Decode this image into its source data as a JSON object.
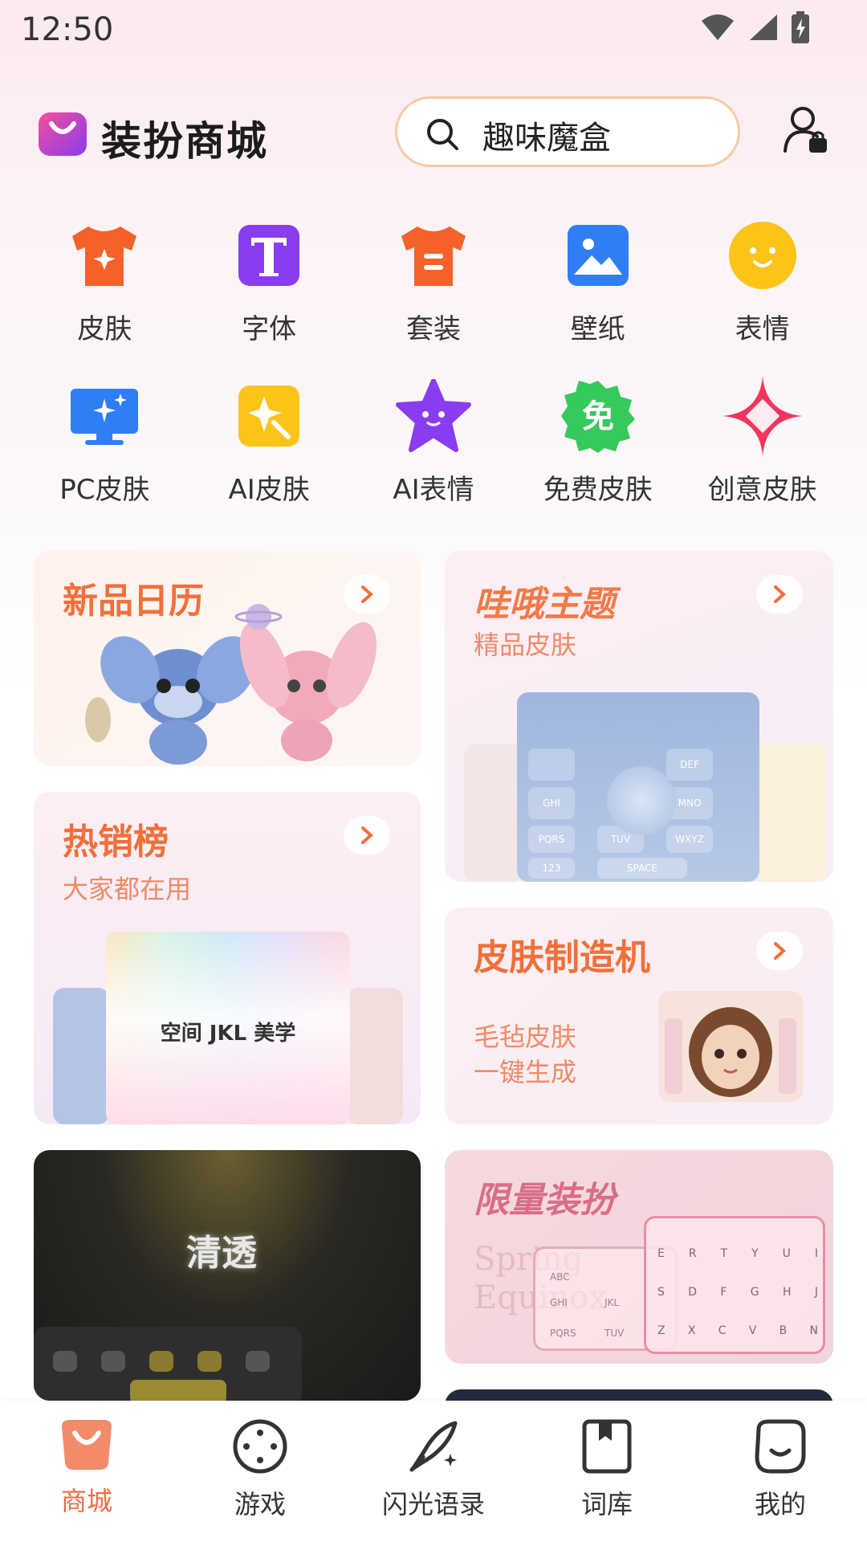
{
  "status": {
    "time": "12:50"
  },
  "header": {
    "title": "装扮商城",
    "search_placeholder": "趣味魔盒"
  },
  "categories": [
    {
      "label": "皮肤",
      "icon": "tshirt-star-icon",
      "color": "#f4622a"
    },
    {
      "label": "字体",
      "icon": "font-t-icon",
      "color": "#8a3cf0"
    },
    {
      "label": "套装",
      "icon": "tshirt-suit-icon",
      "color": "#f4622a"
    },
    {
      "label": "壁纸",
      "icon": "picture-icon",
      "color": "#2f7ef6"
    },
    {
      "label": "表情",
      "icon": "smiley-icon",
      "color": "#fcc419"
    },
    {
      "label": "PC皮肤",
      "icon": "monitor-icon",
      "color": "#2f7ef6"
    },
    {
      "label": "AI皮肤",
      "icon": "ai-star-icon",
      "color": "#fcc419"
    },
    {
      "label": "AI表情",
      "icon": "star-face-icon",
      "color": "#8a3cf0"
    },
    {
      "label": "免费皮肤",
      "icon": "free-badge-icon",
      "color": "#36c95b"
    },
    {
      "label": "创意皮肤",
      "icon": "sparkle-icon",
      "color": "#f0355f"
    }
  ],
  "cards": {
    "calendar": {
      "title": "新品日历"
    },
    "wow_theme": {
      "title": "哇哦主题",
      "subtitle": "精品皮肤"
    },
    "hot": {
      "title": "热销榜",
      "subtitle": "大家都在用",
      "preview_text": "空间 JKL 美学"
    },
    "maker": {
      "title": "皮肤制造机",
      "subtitle_line1": "毛毡皮肤",
      "subtitle_line2": "一键生成"
    },
    "clear": {
      "title": "清透"
    },
    "limited": {
      "title": "限量装扮",
      "watermark": "Spring Equinox"
    }
  },
  "keyboard_labels": {
    "def": "DEF",
    "ghi": "GHI",
    "mno": "MNO",
    "pqrs": "PQRS",
    "tuv": "TUV",
    "wxyz": "WXYZ",
    "space": "SPACE",
    "num": "123",
    "abc": "ABC",
    "jkl": "JKL",
    "row1": [
      "E",
      "R",
      "T",
      "Y",
      "U",
      "I"
    ],
    "row2": [
      "S",
      "D",
      "F",
      "G",
      "H",
      "J"
    ],
    "row3": [
      "Z",
      "X",
      "C",
      "V",
      "B",
      "N"
    ]
  },
  "bottom_nav": [
    {
      "label": "商城",
      "icon": "shop-bag-icon",
      "active": true
    },
    {
      "label": "游戏",
      "icon": "game-icon",
      "active": false
    },
    {
      "label": "闪光语录",
      "icon": "quill-icon",
      "active": false
    },
    {
      "label": "词库",
      "icon": "book-icon",
      "active": false
    },
    {
      "label": "我的",
      "icon": "me-face-icon",
      "active": false
    }
  ],
  "colors": {
    "accent": "#f06a44",
    "card_title": "#f0703a"
  }
}
